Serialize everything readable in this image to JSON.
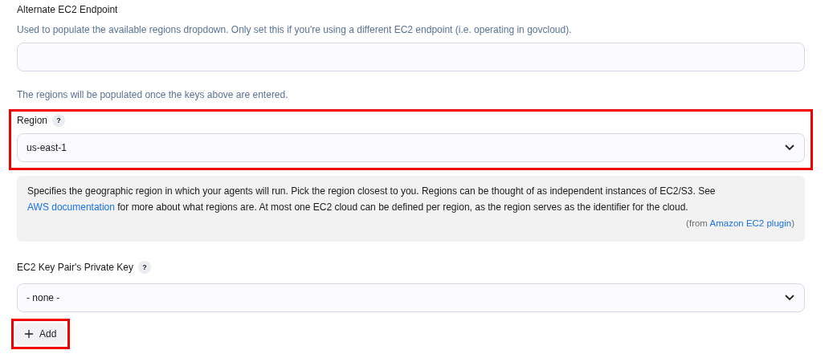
{
  "endpoint": {
    "label": "Alternate EC2 Endpoint",
    "description": "Used to populate the available regions dropdown. Only set this if you're using a different EC2 endpoint (i.e. operating in govcloud)."
  },
  "regions_note": "The regions will be populated once the keys above are entered.",
  "region": {
    "label": "Region",
    "help_icon": "?",
    "value": "us-east-1",
    "highlighted": true
  },
  "region_help": {
    "before_link": "Specifies the geographic region in which your agents will run. Pick the region closest to you. Regions can be thought of as independent instances of EC2/S3. See ",
    "link": "AWS documentation",
    "after_link": " for more about what regions are. At most one EC2 cloud can be defined per region, as the region serves as the identifier for the cloud.",
    "from_prefix": "(from ",
    "from_link": "Amazon EC2 plugin",
    "from_suffix": ")"
  },
  "key": {
    "label": "EC2 Key Pair's Private Key",
    "help_icon": "?",
    "value": "- none -"
  },
  "add_button": {
    "label": "Add",
    "highlighted": true
  }
}
